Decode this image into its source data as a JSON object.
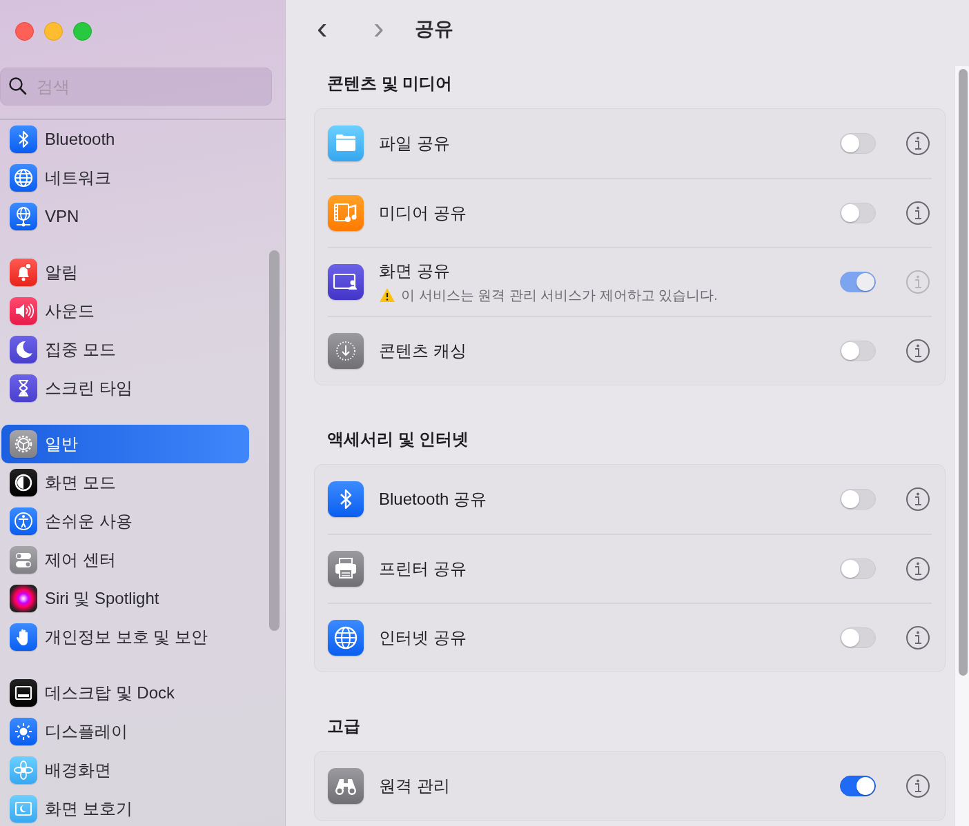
{
  "sidebar": {
    "search": {
      "placeholder": "검색"
    },
    "groups": [
      [
        {
          "label": "Bluetooth",
          "selected": false
        },
        {
          "label": "네트워크",
          "selected": false
        },
        {
          "label": "VPN",
          "selected": false
        }
      ],
      [
        {
          "label": "알림",
          "selected": false
        },
        {
          "label": "사운드",
          "selected": false
        },
        {
          "label": "집중 모드",
          "selected": false
        },
        {
          "label": "스크린 타임",
          "selected": false
        }
      ],
      [
        {
          "label": "일반",
          "selected": true
        },
        {
          "label": "화면 모드",
          "selected": false
        },
        {
          "label": "손쉬운 사용",
          "selected": false
        },
        {
          "label": "제어 센터",
          "selected": false
        },
        {
          "label": "Siri 및 Spotlight",
          "selected": false
        },
        {
          "label": "개인정보 보호 및 보안",
          "selected": false
        }
      ],
      [
        {
          "label": "데스크탑 및 Dock",
          "selected": false
        },
        {
          "label": "디스플레이",
          "selected": false
        },
        {
          "label": "배경화면",
          "selected": false
        },
        {
          "label": "화면 보호기",
          "selected": false
        }
      ]
    ]
  },
  "toolbar": {
    "back": "‹",
    "forward": "›",
    "title": "공유"
  },
  "sections": [
    {
      "title": "콘텐츠 및 미디어",
      "rows": [
        {
          "label": "파일 공유",
          "on": false,
          "disabled": false
        },
        {
          "label": "미디어 공유",
          "on": false,
          "disabled": false
        },
        {
          "label": "화면 공유",
          "note": "이 서비스는 원격 관리 서비스가 제어하고 있습니다.",
          "on": true,
          "disabled": true
        },
        {
          "label": "콘텐츠 캐싱",
          "on": false,
          "disabled": false
        }
      ]
    },
    {
      "title": "액세서리 및 인터넷",
      "rows": [
        {
          "label": "Bluetooth 공유",
          "on": false,
          "disabled": false
        },
        {
          "label": "프린터 공유",
          "on": false,
          "disabled": false
        },
        {
          "label": "인터넷 공유",
          "on": false,
          "disabled": false
        }
      ]
    },
    {
      "title": "고급",
      "rows": [
        {
          "label": "원격 관리",
          "on": true,
          "disabled": false
        }
      ]
    }
  ]
}
